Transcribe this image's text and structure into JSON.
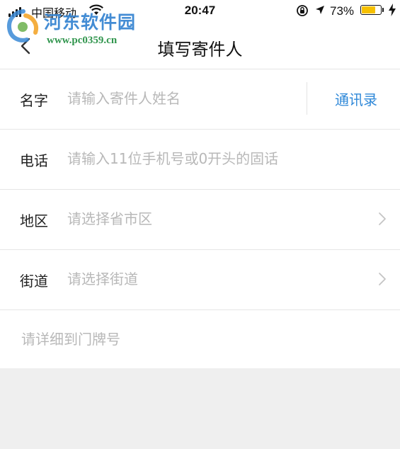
{
  "status_bar": {
    "carrier": "中国移动",
    "time": "20:47",
    "battery_percent": "73%",
    "battery_level": 0.73,
    "icons": [
      "signal-icon",
      "wifi-icon",
      "orientation-lock-icon",
      "location-icon",
      "battery-icon",
      "charging-icon"
    ]
  },
  "nav": {
    "title": "填写寄件人",
    "back_icon": "chevron-left-icon"
  },
  "watermark": {
    "title": "河东软件园",
    "url": "www.pc0359.cn"
  },
  "form": {
    "name": {
      "label": "名字",
      "placeholder": "请输入寄件人姓名",
      "value": "",
      "contacts_link": "通讯录"
    },
    "phone": {
      "label": "电话",
      "placeholder": "请输入11位手机号或0开头的固话",
      "value": ""
    },
    "region": {
      "label": "地区",
      "placeholder": "请选择省市区",
      "value": ""
    },
    "street": {
      "label": "街道",
      "placeholder": "请选择街道",
      "value": ""
    },
    "detail": {
      "placeholder": "请详细到门牌号",
      "value": ""
    }
  },
  "colors": {
    "accent": "#2f88d8",
    "placeholder": "#b8b8b8",
    "background": "#efefef",
    "battery": "#f6c000"
  }
}
